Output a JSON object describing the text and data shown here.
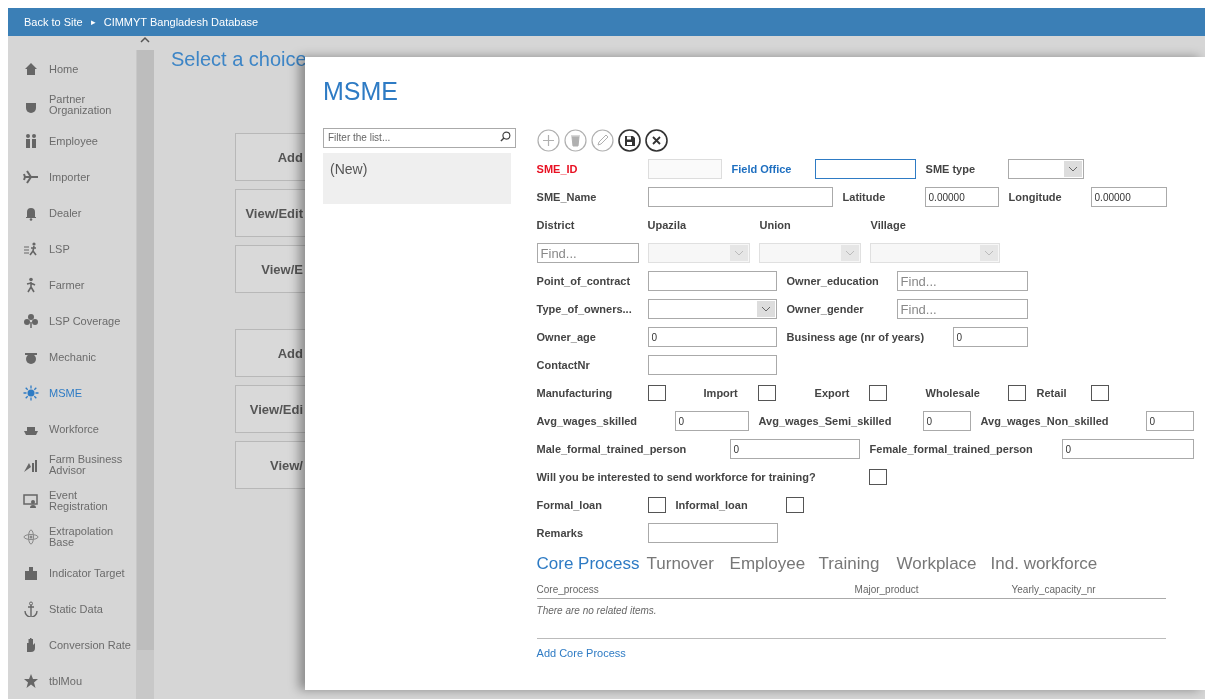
{
  "top_bar": {
    "back_link": "Back to Site",
    "separator": "▸",
    "site_title": "CIMMYT Bangladesh Database"
  },
  "sidebar": {
    "items": [
      {
        "label": "Home",
        "selected": false
      },
      {
        "label": "Partner Organization",
        "selected": false
      },
      {
        "label": "Employee",
        "selected": false
      },
      {
        "label": "Importer",
        "selected": false
      },
      {
        "label": "Dealer",
        "selected": false
      },
      {
        "label": "LSP",
        "selected": false
      },
      {
        "label": "Farmer",
        "selected": false
      },
      {
        "label": "LSP Coverage",
        "selected": false
      },
      {
        "label": "Mechanic",
        "selected": false
      },
      {
        "label": "MSME",
        "selected": true
      },
      {
        "label": "Workforce",
        "selected": false
      },
      {
        "label": "Farm Business Advisor",
        "selected": false
      },
      {
        "label": "Event Registration",
        "selected": false
      },
      {
        "label": "Extrapolation Base",
        "selected": false
      },
      {
        "label": "Indicator Target",
        "selected": false
      },
      {
        "label": "Static Data",
        "selected": false
      },
      {
        "label": "Conversion Rate",
        "selected": false
      },
      {
        "label": "tblMou",
        "selected": false
      }
    ]
  },
  "main": {
    "title": "Select a choice",
    "buttons": [
      "Add",
      "View/Edit",
      "View/E",
      "Add",
      "View/Edi",
      "View/"
    ]
  },
  "dialog": {
    "title": "MSME",
    "filter": {
      "placeholder": "Filter the list..."
    },
    "list_items": [
      {
        "label": "(New)",
        "selected": true
      }
    ],
    "toolbar": [
      {
        "kind": "add",
        "disabled": true
      },
      {
        "kind": "delete",
        "disabled": true
      },
      {
        "kind": "edit",
        "disabled": true
      },
      {
        "kind": "save",
        "disabled": false
      },
      {
        "kind": "cancel",
        "disabled": false
      }
    ],
    "form_rows": [
      [
        {
          "kind": "label",
          "text": "SME_ID",
          "color": "#e81123"
        },
        {
          "kind": "text",
          "disabled": true,
          "focused": false
        },
        {
          "kind": "label",
          "text": "Field Office",
          "color": "#1e6fc0"
        },
        {
          "kind": "text",
          "disabled": false,
          "focused": true
        },
        {
          "kind": "label",
          "text": "SME type"
        },
        {
          "kind": "dropdown",
          "disabled": false
        }
      ],
      [
        {
          "kind": "label",
          "text": "SME_Name"
        },
        {
          "kind": "text",
          "disabled": false,
          "focused": false
        },
        {
          "kind": "label",
          "text": "Latitude"
        },
        {
          "kind": "text",
          "value": "0.00000",
          "disabled": false,
          "focused": false
        },
        {
          "kind": "label",
          "text": "Longitude"
        },
        {
          "kind": "text",
          "value": "0.00000",
          "disabled": false,
          "focused": false
        }
      ],
      [
        {
          "kind": "label",
          "text": "District"
        },
        {
          "kind": "label",
          "text": "Upazila"
        },
        {
          "kind": "label",
          "text": "Union"
        },
        {
          "kind": "label",
          "text": "Village"
        }
      ],
      [
        {
          "kind": "find",
          "placeholder": "Find..."
        },
        {
          "kind": "dropdown",
          "disabled": true
        },
        {
          "kind": "dropdown",
          "disabled": true
        },
        {
          "kind": "dropdown",
          "disabled": true
        }
      ],
      [
        {
          "kind": "label",
          "text": "Point_of_contract"
        },
        {
          "kind": "text",
          "disabled": false,
          "focused": false
        },
        {
          "kind": "label",
          "text": "Owner_education"
        },
        {
          "kind": "find",
          "placeholder": "Find..."
        }
      ],
      [
        {
          "kind": "label",
          "text": "Type_of_owners..."
        },
        {
          "kind": "dropdown",
          "disabled": false
        },
        {
          "kind": "label",
          "text": "Owner_gender"
        },
        {
          "kind": "find",
          "placeholder": "Find..."
        }
      ],
      [
        {
          "kind": "label",
          "text": "Owner_age"
        },
        {
          "kind": "text",
          "value": "0",
          "disabled": false,
          "focused": false
        },
        {
          "kind": "label",
          "text": "Business age (nr of years)"
        },
        {
          "kind": "text",
          "value": "0",
          "disabled": false,
          "focused": false
        }
      ],
      [
        {
          "kind": "label",
          "text": "ContactNr"
        },
        {
          "kind": "text",
          "disabled": false,
          "focused": false
        }
      ],
      [
        {
          "kind": "label",
          "text": "Manufacturing"
        },
        {
          "kind": "checkbox",
          "checked": false
        },
        {
          "kind": "label",
          "text": "Import"
        },
        {
          "kind": "checkbox",
          "checked": false
        },
        {
          "kind": "label",
          "text": "Export"
        },
        {
          "kind": "checkbox",
          "checked": false
        },
        {
          "kind": "label",
          "text": "Wholesale"
        },
        {
          "kind": "checkbox",
          "checked": false
        },
        {
          "kind": "label",
          "text": "Retail"
        },
        {
          "kind": "checkbox",
          "checked": false
        }
      ],
      [
        {
          "kind": "label",
          "text": "Avg_wages_skilled"
        },
        {
          "kind": "text",
          "value": "0",
          "disabled": false,
          "focused": false
        },
        {
          "kind": "label",
          "text": "Avg_wages_Semi_skilled"
        },
        {
          "kind": "text",
          "value": "0",
          "disabled": false,
          "focused": false
        },
        {
          "kind": "label",
          "text": "Avg_wages_Non_skilled"
        },
        {
          "kind": "text",
          "value": "0",
          "disabled": false,
          "focused": false
        }
      ],
      [
        {
          "kind": "label",
          "text": "Male_formal_trained_person"
        },
        {
          "kind": "text",
          "value": "0",
          "disabled": false,
          "focused": false
        },
        {
          "kind": "label",
          "text": "Female_formal_trained_person"
        },
        {
          "kind": "text",
          "value": "0",
          "disabled": false,
          "focused": false
        }
      ],
      [
        {
          "kind": "label",
          "text": "Will you be interested to send workforce for training?"
        },
        {
          "kind": "checkbox",
          "checked": false
        }
      ],
      [
        {
          "kind": "label",
          "text": "Formal_loan"
        },
        {
          "kind": "checkbox",
          "checked": false
        },
        {
          "kind": "label",
          "text": "Informal_loan"
        },
        {
          "kind": "checkbox",
          "checked": false
        }
      ],
      [
        {
          "kind": "label",
          "text": "Remarks"
        },
        {
          "kind": "text",
          "disabled": false,
          "focused": false
        }
      ]
    ],
    "tabs": [
      {
        "label": "Core Process",
        "selected": true
      },
      {
        "label": "Turnover",
        "selected": false
      },
      {
        "label": "Employee",
        "selected": false
      },
      {
        "label": "Training",
        "selected": false
      },
      {
        "label": "Workplace",
        "selected": false
      },
      {
        "label": "Ind. workforce",
        "selected": false
      }
    ],
    "table": {
      "columns": [
        "Core_process",
        "Major_product",
        "Yearly_capacity_nr"
      ],
      "empty_message": "There are no related items."
    },
    "add_link": "Add Core Process"
  }
}
